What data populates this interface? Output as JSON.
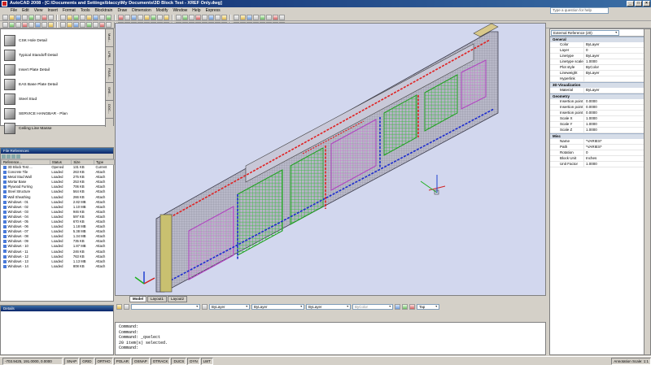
{
  "window": {
    "title": "AutoCAD 2008 - [C:\\Documents and Settings\\blaccy\\My Documents\\3D Block Test - XREF Only.dwg]",
    "search_placeholder": "Type a question for help"
  },
  "menu": [
    "File",
    "Edit",
    "View",
    "Insert",
    "Format",
    "Tools",
    "Blocktrain",
    "Draw",
    "Dimension",
    "Modify",
    "Window",
    "Help",
    "Express"
  ],
  "tool_palette": {
    "items": [
      "CSK Hole Detail",
      "Typical Standoff Detail",
      "Insert Plate Detail",
      "EAS Base Plate Detail",
      "Steel Stud",
      "SERVICE HANGBAR - Plan",
      "Ceiling Line Masse"
    ],
    "tabs": [
      "Mod...",
      "LPB...",
      "FEAS...",
      "SHE...",
      "DOC..."
    ]
  },
  "file_references": {
    "title": "File References",
    "columns": [
      "Reference...",
      "Status",
      "Size",
      "Type"
    ],
    "rows": [
      [
        "3D Block Test ...",
        "Opened",
        "131 KB",
        "Current"
      ],
      [
        "Concrete Tile",
        "Loaded",
        "263 KB",
        "Attach"
      ],
      [
        "Metal Stud Wall",
        "Loaded",
        "275 KB",
        "Attach"
      ],
      [
        "Mortar Base",
        "Loaded",
        "253 KB",
        "Attach"
      ],
      [
        "Plywood Furring",
        "Loaded",
        "706 KB",
        "Attach"
      ],
      [
        "Steel Structure",
        "Loaded",
        "564 KB",
        "Attach"
      ],
      [
        "Wall Sheathing",
        "Loaded",
        "266 KB",
        "Attach"
      ],
      [
        "Windows - 01",
        "Loaded",
        "2.82 MB",
        "Attach"
      ],
      [
        "Windows - 02",
        "Loaded",
        "1.10 MB",
        "Attach"
      ],
      [
        "Windows - 03",
        "Loaded",
        "946 KB",
        "Attach"
      ],
      [
        "Windows - 04",
        "Loaded",
        "597 KB",
        "Attach"
      ],
      [
        "Windows - 05",
        "Loaded",
        "670 KB",
        "Attach"
      ],
      [
        "Windows - 06",
        "Loaded",
        "1.18 MB",
        "Attach"
      ],
      [
        "Windows - 07",
        "Loaded",
        "5.38 MB",
        "Attach"
      ],
      [
        "Windows - 08",
        "Loaded",
        "1.34 MB",
        "Attach"
      ],
      [
        "Windows - 09",
        "Loaded",
        "735 KB",
        "Attach"
      ],
      [
        "Windows - 10",
        "Loaded",
        "1.87 MB",
        "Attach"
      ],
      [
        "Windows - 11",
        "Loaded",
        "246 KB",
        "Attach"
      ],
      [
        "Windows - 12",
        "Loaded",
        "763 KB",
        "Attach"
      ],
      [
        "Windows - 13",
        "Loaded",
        "1.13 MB",
        "Attach"
      ],
      [
        "Windows - 14",
        "Loaded",
        "808 KB",
        "Attach"
      ]
    ]
  },
  "details": {
    "title": "Details"
  },
  "layout_tabs": [
    "Model",
    "Layout1",
    "Layout2"
  ],
  "layer_bar": {
    "layer": "ByLayer",
    "linetype": "ByLayer",
    "lineweight": "ByLayer",
    "plotstyle": "ByColor",
    "tab": "Tap"
  },
  "command": {
    "lines": [
      "Command:",
      "Command:",
      "Command: _qselect",
      "20 item(s) selected.",
      "Command:"
    ]
  },
  "status": {
    "coords": "-703.9425, 191.0000, 0.0000",
    "toggles": [
      "SNAP",
      "GRID",
      "ORTHO",
      "POLAR",
      "OSNAP",
      "OTRACK",
      "DUCS",
      "DYN",
      "LWT"
    ],
    "annotation": "Annotation Scale: 1:1"
  },
  "properties": {
    "selector": "External Reference (20)",
    "sections": [
      {
        "name": "General",
        "rows": [
          [
            "Color",
            "ByLayer"
          ],
          [
            "Layer",
            "0"
          ],
          [
            "Linetype",
            "ByLayer"
          ],
          [
            "Linetype scale",
            "1.0000"
          ],
          [
            "Plot style",
            "ByColor"
          ],
          [
            "Lineweight",
            "ByLayer"
          ],
          [
            "Hyperlink",
            ""
          ]
        ]
      },
      {
        "name": "3D Visualization",
        "rows": [
          [
            "Material",
            "ByLayer"
          ]
        ]
      },
      {
        "name": "Geometry",
        "rows": [
          [
            "Insertion point X",
            "0.0000"
          ],
          [
            "Insertion point Y",
            "0.0000"
          ],
          [
            "Insertion point Z",
            "0.0000"
          ],
          [
            "Scale X",
            "1.0000"
          ],
          [
            "Scale Y",
            "1.0000"
          ],
          [
            "Scale Z",
            "1.0000"
          ]
        ]
      },
      {
        "name": "Misc",
        "rows": [
          [
            "Name",
            "*VARIES*"
          ],
          [
            "Path",
            "*VARIES*"
          ],
          [
            "Rotation",
            "0"
          ],
          [
            "Block Unit",
            "Inches"
          ],
          [
            "Unit Factor",
            "1.0000"
          ]
        ]
      }
    ]
  },
  "colors": {
    "drawing_bg": "#d2d7ee",
    "title_blue": "#0a246a"
  }
}
